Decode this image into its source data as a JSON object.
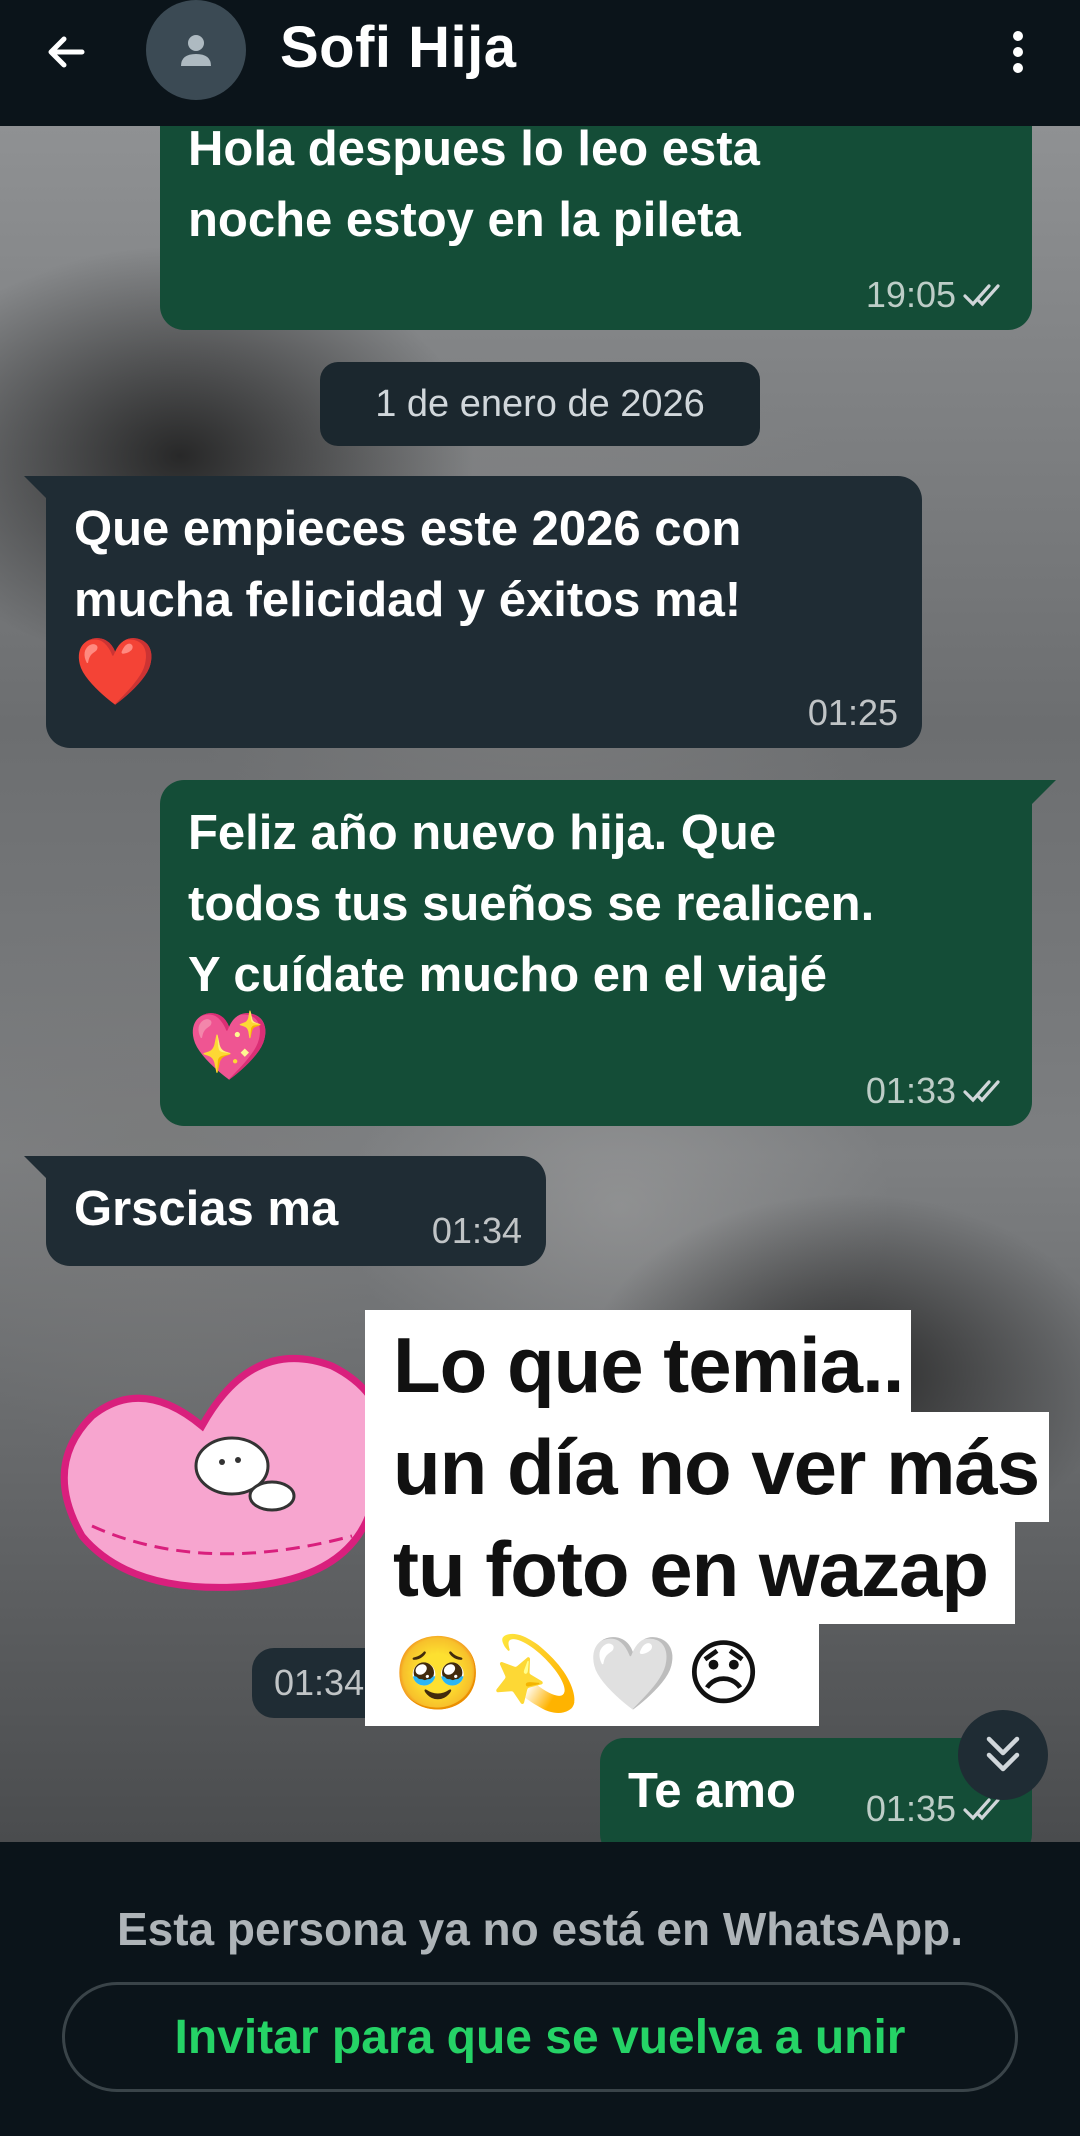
{
  "header": {
    "contact_name": "Sofi Hija",
    "back_icon": "arrow-left-icon",
    "avatar_icon": "person-icon",
    "menu_icon": "more-vertical-icon"
  },
  "chat": {
    "messages": [
      {
        "direction": "out",
        "text_lines": [
          "Hola despues lo leo esta",
          "noche estoy en la pileta"
        ],
        "time": "19:05",
        "status": "read"
      },
      {
        "direction": "in",
        "text_lines": [
          "Que empieces este 2026 con",
          "mucha felicidad y éxitos ma!"
        ],
        "emoji": "❤️",
        "time": "01:25"
      },
      {
        "direction": "out",
        "text_lines": [
          "Feliz año nuevo hija. Que",
          "todos tus sueños se realicen.",
          "Y cuídate mucho en el viajé"
        ],
        "emoji": "💖",
        "time": "01:33",
        "status": "read"
      },
      {
        "direction": "in",
        "text_lines": [
          "Grscias ma"
        ],
        "time": "01:34"
      },
      {
        "direction": "in",
        "type": "sticker",
        "sticker": "pink-heart-bunny-sticker",
        "time": "01:34"
      },
      {
        "direction": "out",
        "text_lines": [
          "Te amo"
        ],
        "time": "01:35",
        "status": "read"
      }
    ],
    "date_divider": "1 de enero de 2026",
    "scroll_icon": "double-chevron-down-icon"
  },
  "overlay_caption": {
    "lines": [
      "Lo que temia..",
      "un día no ver más",
      "tu foto en wazap"
    ],
    "emojis": "🥹💫🤍😞"
  },
  "footer": {
    "notice": "Esta persona ya no está en WhatsApp.",
    "invite_button": "Invitar para que se vuelva a unir"
  },
  "colors": {
    "background": "#0b141a",
    "outgoing_bubble": "#144d37",
    "incoming_bubble": "#1f2c34",
    "accent": "#25d366"
  }
}
